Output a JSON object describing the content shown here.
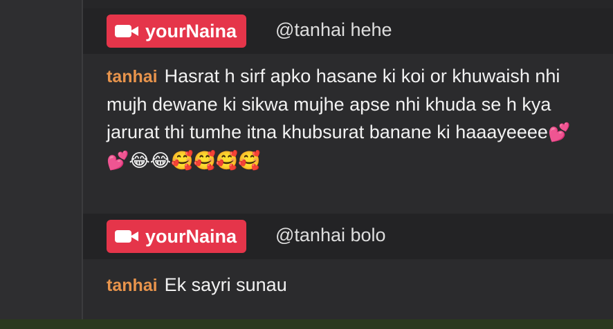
{
  "messages": [
    {
      "type": "host",
      "badge_name": "yourNaina",
      "text": "@tanhai hehe"
    },
    {
      "type": "chat",
      "sender": "tanhai",
      "text": "Hasrat h sirf apko hasane ki koi or khuwaish nhi mujh dewane ki sikwa mujhe apse nhi khuda se h kya jarurat thi tumhe itna khubsurat banane ki haaayeeee",
      "emojis": "💕💕😂😂🥰🥰🥰🥰"
    },
    {
      "type": "host",
      "badge_name": "yourNaina",
      "text": "@tanhai bolo"
    },
    {
      "type": "chat",
      "sender": "tanhai",
      "text": "Ek sayri sunau"
    }
  ],
  "colors": {
    "badge": "#e5354a",
    "sender": "#e8944c",
    "background": "#2b2b2d",
    "host_row": "#232325"
  },
  "icons": {
    "host_badge_icon": "video-camera-icon"
  }
}
